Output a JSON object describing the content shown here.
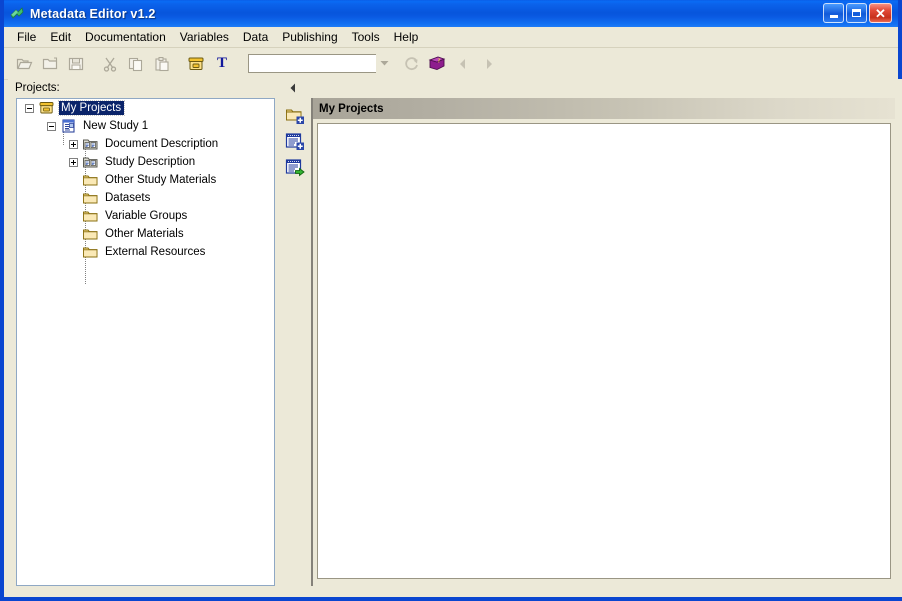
{
  "window": {
    "title": "Metadata Editor v1.2",
    "app_icon": "app-logo-icon",
    "controls": {
      "minimize": "minimize-button",
      "maximize": "maximize-button",
      "close": "close-button",
      "close_glyph": "✕"
    }
  },
  "menubar": {
    "items": [
      {
        "label": "File"
      },
      {
        "label": "Edit"
      },
      {
        "label": "Documentation"
      },
      {
        "label": "Variables"
      },
      {
        "label": "Data"
      },
      {
        "label": "Publishing"
      },
      {
        "label": "Tools"
      },
      {
        "label": "Help"
      }
    ]
  },
  "toolbar": {
    "buttons": [
      {
        "name": "open-project-icon",
        "enabled": false
      },
      {
        "name": "open-folder-icon",
        "enabled": false
      },
      {
        "name": "save-icon",
        "enabled": false
      },
      {
        "name": "cut-icon",
        "enabled": false
      },
      {
        "name": "copy-icon",
        "enabled": false
      },
      {
        "name": "paste-icon",
        "enabled": false
      },
      {
        "name": "archive-box-icon",
        "enabled": true
      },
      {
        "name": "text-tool-icon",
        "enabled": true
      }
    ],
    "combo": {
      "value": "",
      "placeholder": ""
    },
    "combo_arrow_icon": "chevron-down-icon",
    "refresh_icon": "refresh-icon",
    "help_book_icon": "help-book-icon",
    "back_icon": "back-arrow-icon",
    "forward_icon": "forward-arrow-icon"
  },
  "sidebar": {
    "label": "Projects:",
    "collapse_icon": "collapse-left-icon",
    "tools": [
      {
        "name": "add-folder-button",
        "title": "Add Folder"
      },
      {
        "name": "add-form-button",
        "title": "Add Form"
      },
      {
        "name": "import-form-button",
        "title": "Import Form"
      }
    ],
    "tree": [
      {
        "label": "My Projects",
        "depth": 0,
        "icon": "archive-box-icon",
        "expander": "minus",
        "selected": true
      },
      {
        "label": "New Study 1",
        "depth": 1,
        "icon": "study-document-icon",
        "expander": "minus",
        "selected": false
      },
      {
        "label": "Document Description",
        "depth": 2,
        "icon": "description-folder-icon",
        "expander": "plus",
        "selected": false
      },
      {
        "label": "Study Description",
        "depth": 2,
        "icon": "description-folder-icon",
        "expander": "plus",
        "selected": false
      },
      {
        "label": "Other Study Materials",
        "depth": 2,
        "icon": "folder-icon",
        "expander": "none",
        "selected": false
      },
      {
        "label": "Datasets",
        "depth": 2,
        "icon": "folder-icon",
        "expander": "none",
        "selected": false
      },
      {
        "label": "Variable Groups",
        "depth": 2,
        "icon": "folder-icon",
        "expander": "none",
        "selected": false
      },
      {
        "label": "Other Materials",
        "depth": 2,
        "icon": "folder-icon",
        "expander": "none",
        "selected": false
      },
      {
        "label": "External Resources",
        "depth": 2,
        "icon": "folder-icon",
        "expander": "none",
        "selected": false
      }
    ]
  },
  "main": {
    "header_title": "My Projects",
    "content": ""
  },
  "colors": {
    "chrome": "#ECE9D8",
    "titlebar_blue": "#0A5AE2",
    "selection_blue": "#0A246A",
    "folder_yellow": "#F5D76E",
    "accent_close_red": "#C7301C"
  }
}
